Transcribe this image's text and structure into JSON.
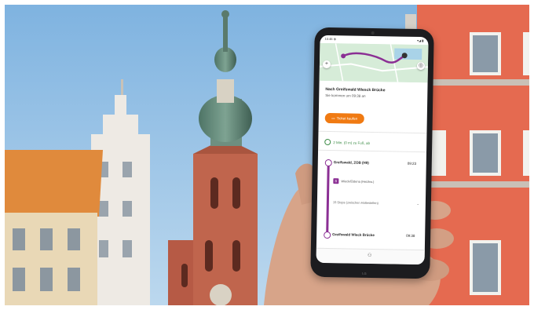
{
  "phone": {
    "status_time": "10:46 ⊕",
    "status_icons": "▾◢ ▮",
    "map": {
      "route_color": "#8b2f94",
      "add_icon": "plus-icon",
      "locate_icon": "locate-icon"
    },
    "destination_title": "Nach Greifswald Wiesck Brücke",
    "arrival_text": "Sie kommen um 09:38 an",
    "cta_label": "Ticket kaufen",
    "walk_text": "2 Min. (0 m) zu Fuß, ab",
    "departure_stop": "Greifswald, ZOB (H9)",
    "departure_time": "09:23",
    "line_label": "B",
    "line_direction": "Wieck/Eldena (Heizkw.)",
    "intermediate_stops": "15 Stops (zwischen Haltestellen)",
    "arrival_stop": "Greifswald Wieck Brücke",
    "arrival_time": "09:38",
    "brand": "LG",
    "accent_color": "#f07a12",
    "line_color": "#8b2f94"
  }
}
